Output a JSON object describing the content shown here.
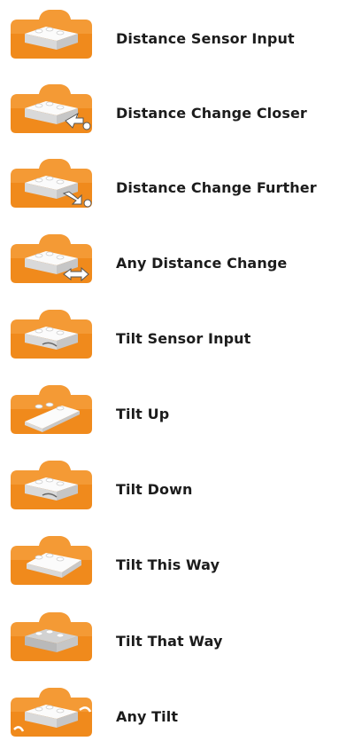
{
  "colors": {
    "block_orange": "#f08a1c",
    "block_orange_light": "#f7a84a",
    "block_tab": "#f39a2e",
    "brick_white": "#f2f2f2",
    "brick_gray": "#b9b9b9",
    "arrow_white": "#ffffff"
  },
  "blocks": [
    {
      "label": "Distance Sensor Input",
      "icon": "distance-sensor-brick-icon",
      "extra": "none"
    },
    {
      "label": "Distance Change Closer",
      "icon": "distance-closer-icon",
      "extra": "closer"
    },
    {
      "label": "Distance Change Further",
      "icon": "distance-further-icon",
      "extra": "further"
    },
    {
      "label": "Any Distance Change",
      "icon": "distance-any-change-icon",
      "extra": "any"
    },
    {
      "label": "Tilt Sensor Input",
      "icon": "tilt-sensor-brick-icon",
      "extra": "tilt"
    },
    {
      "label": "Tilt Up",
      "icon": "tilt-up-icon",
      "extra": "tiltup"
    },
    {
      "label": "Tilt Down",
      "icon": "tilt-down-icon",
      "extra": "tiltdown"
    },
    {
      "label": "Tilt This Way",
      "icon": "tilt-this-way-icon",
      "extra": "tiltthis"
    },
    {
      "label": "Tilt That Way",
      "icon": "tilt-that-way-icon",
      "extra": "tiltthat"
    },
    {
      "label": "Any Tilt",
      "icon": "any-tilt-icon",
      "extra": "anytilt"
    }
  ]
}
